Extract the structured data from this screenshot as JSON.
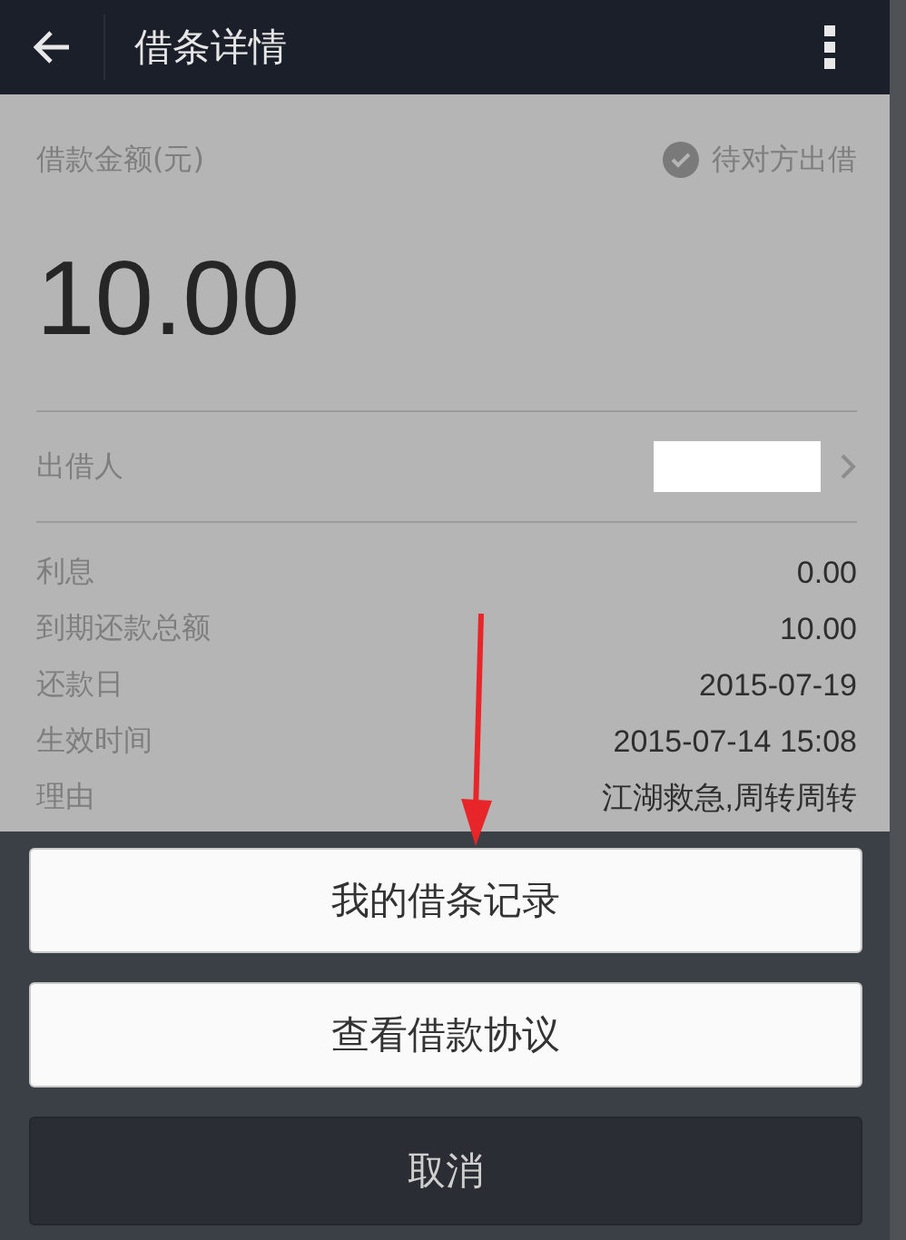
{
  "header": {
    "title": "借条详情"
  },
  "amount": {
    "label": "借款金额(元)",
    "status": "待对方出借",
    "status_checked": true,
    "value": "10.00"
  },
  "lender": {
    "label": "出借人",
    "redacted": true
  },
  "details": [
    {
      "label": "利息",
      "value": "0.00"
    },
    {
      "label": "到期还款总额",
      "value": "10.00"
    },
    {
      "label": "还款日",
      "value": "2015-07-19"
    },
    {
      "label": "生效时间",
      "value": "2015-07-14 15:08"
    },
    {
      "label": "理由",
      "value": "江湖救急,周转周转"
    }
  ],
  "action_sheet": {
    "buttons": [
      {
        "label": "我的借条记录",
        "kind": "action"
      },
      {
        "label": "查看借款协议",
        "kind": "action"
      },
      {
        "label": "取消",
        "kind": "cancel"
      }
    ]
  }
}
